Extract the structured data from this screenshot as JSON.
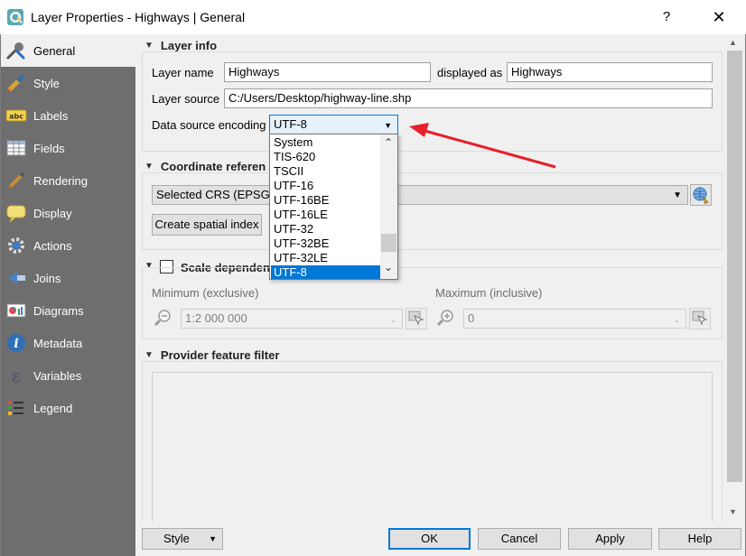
{
  "window": {
    "title": "Layer Properties - Highways | General",
    "help_label": "?",
    "close_label": "✕"
  },
  "sidebar": {
    "items": [
      {
        "label": "General",
        "icon": "wrench-icon"
      },
      {
        "label": "Style",
        "icon": "paintbrush-icon"
      },
      {
        "label": "Labels",
        "icon": "abc-label-icon"
      },
      {
        "label": "Fields",
        "icon": "table-icon"
      },
      {
        "label": "Rendering",
        "icon": "brush-icon"
      },
      {
        "label": "Display",
        "icon": "speech-bubble-icon"
      },
      {
        "label": "Actions",
        "icon": "gear-icon"
      },
      {
        "label": "Joins",
        "icon": "join-arrow-icon"
      },
      {
        "label": "Diagrams",
        "icon": "chart-icon"
      },
      {
        "label": "Metadata",
        "icon": "info-icon"
      },
      {
        "label": "Variables",
        "icon": "epsilon-icon"
      },
      {
        "label": "Legend",
        "icon": "legend-icon"
      }
    ],
    "active_index": 0
  },
  "layer_info": {
    "heading": "Layer info",
    "layer_name_label": "Layer name",
    "layer_name_value": "Highways",
    "displayed_as_label": "displayed as",
    "displayed_as_value": "Highways",
    "layer_source_label": "Layer source",
    "layer_source_value": "C:/Users/Desktop/highway-line.shp",
    "encoding_label": "Data source encoding",
    "encoding_value": "UTF-8"
  },
  "encoding_dropdown": {
    "options": [
      "System",
      "TIS-620",
      "TSCII",
      "UTF-16",
      "UTF-16BE",
      "UTF-16LE",
      "UTF-32",
      "UTF-32BE",
      "UTF-32LE",
      "UTF-8"
    ],
    "selected": "UTF-8"
  },
  "crs": {
    "heading": "Coordinate referen",
    "selected_crs": "Selected CRS (EPSG:4",
    "spatial_index_button": "Create spatial index"
  },
  "scale": {
    "heading": "Scale dependen",
    "minimum_label": "Minimum (exclusive)",
    "minimum_value": "1:2 000 000",
    "maximum_label": "Maximum (inclusive)",
    "maximum_value": "0"
  },
  "provider_filter": {
    "heading": "Provider feature filter"
  },
  "buttons": {
    "style": "Style",
    "ok": "OK",
    "cancel": "Cancel",
    "apply": "Apply",
    "help": "Help"
  },
  "colors": {
    "accent": "#0078d7",
    "sidebar_bg": "#6e6e6e",
    "annotation_arrow": "#e8202a"
  }
}
